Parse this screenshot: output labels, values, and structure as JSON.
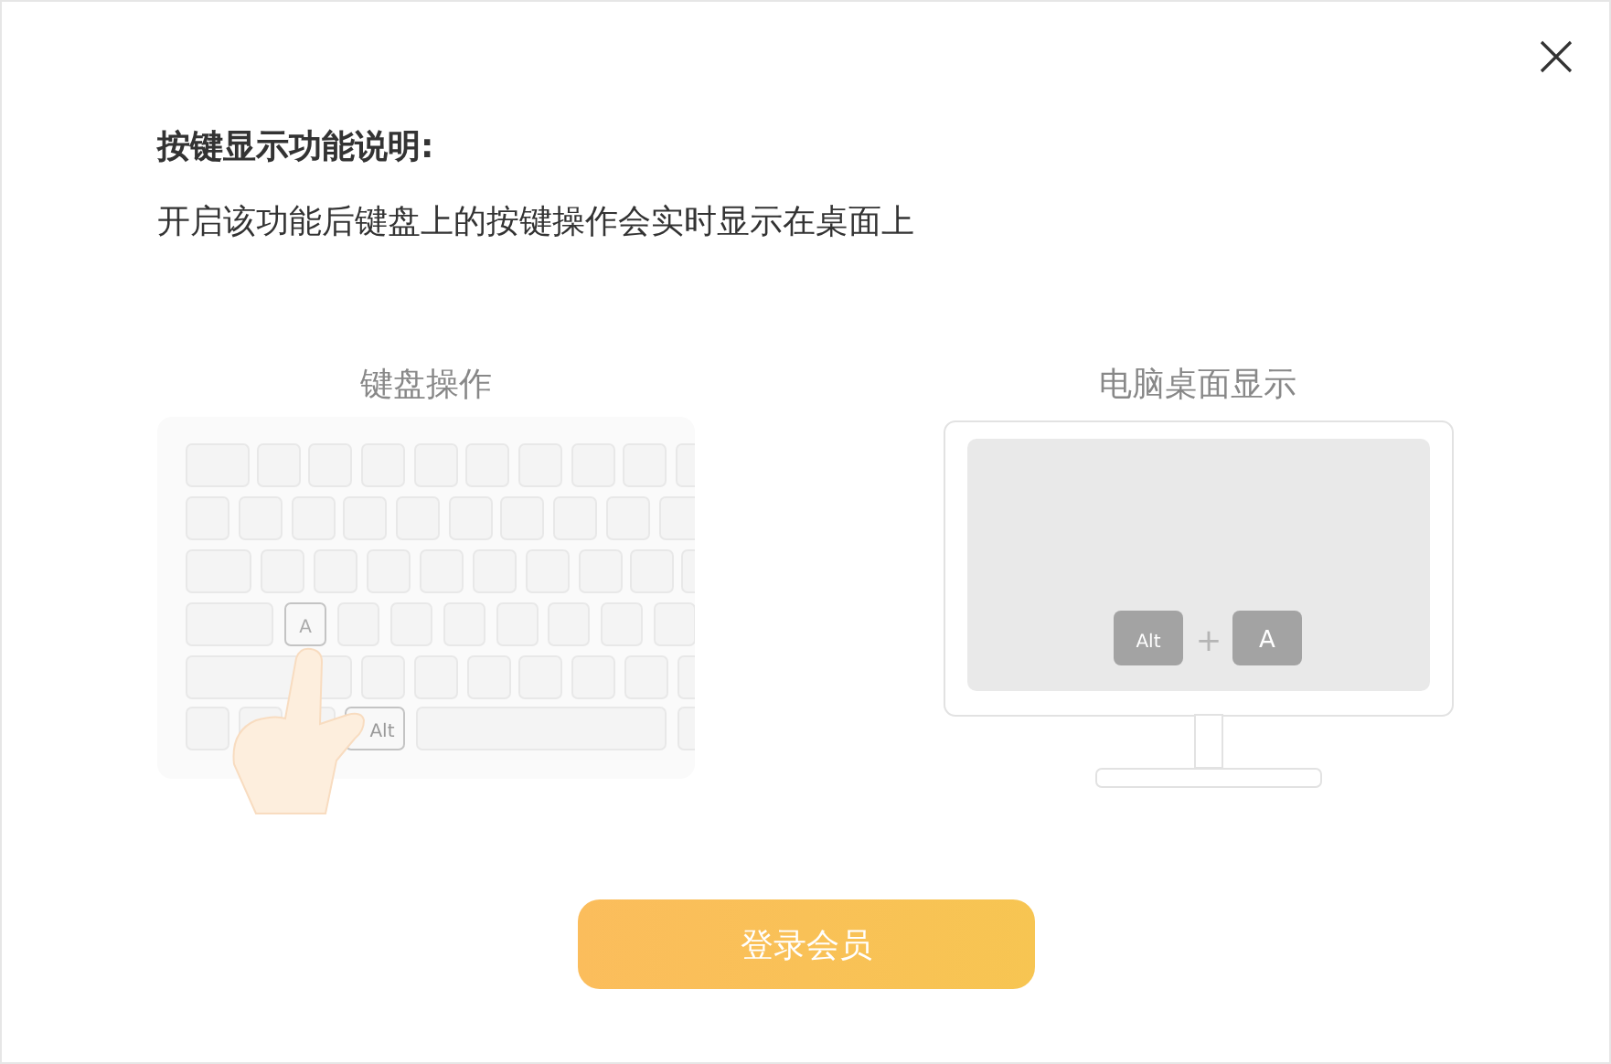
{
  "title": "按键显示功能说明:",
  "description": "开启该功能后键盘上的按键操作会实时显示在桌面上",
  "keyboard_panel": {
    "caption": "键盘操作",
    "pressed_keys": [
      "A",
      "Alt"
    ]
  },
  "desktop_panel": {
    "caption": "电脑桌面显示",
    "key_first": "Alt",
    "plus": "+",
    "key_second": "A"
  },
  "button": {
    "label": "登录会员"
  }
}
